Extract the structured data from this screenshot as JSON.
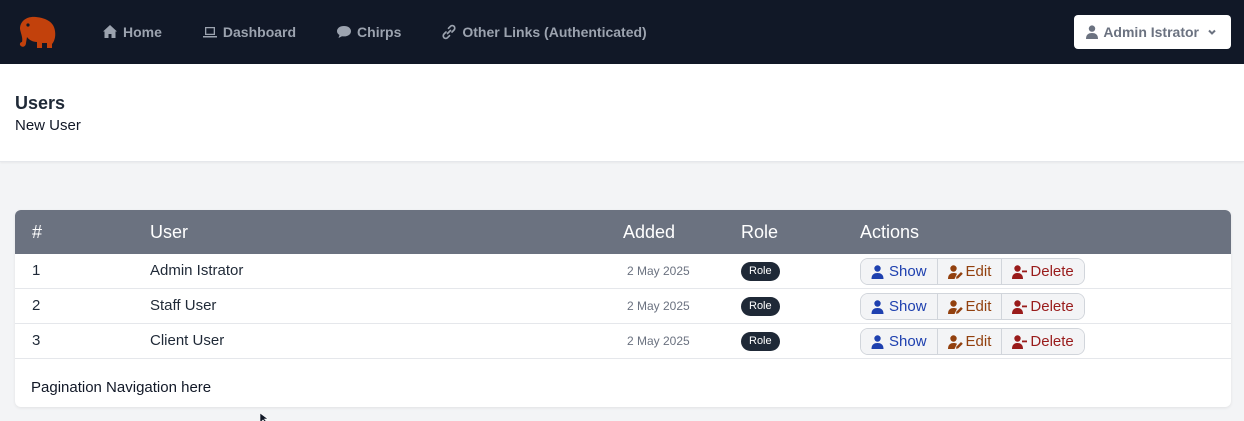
{
  "nav": {
    "logo": "elephant-logo",
    "links": [
      {
        "label": "Home",
        "icon": "home-icon"
      },
      {
        "label": "Dashboard",
        "icon": "laptop-icon"
      },
      {
        "label": "Chirps",
        "icon": "comment-icon"
      },
      {
        "label": "Other Links (Authenticated)",
        "icon": "link-icon"
      }
    ],
    "user_menu": "Admin Istrator"
  },
  "header": {
    "title": "Users",
    "subtitle_link": "New User"
  },
  "table": {
    "columns": [
      "#",
      "User",
      "Added",
      "Role",
      "Actions"
    ],
    "rows": [
      {
        "num": "1",
        "user": "Admin Istrator",
        "added": "2 May 2025",
        "role": "Role"
      },
      {
        "num": "2",
        "user": "Staff User",
        "added": "2 May 2025",
        "role": "Role"
      },
      {
        "num": "3",
        "user": "Client User",
        "added": "2 May 2025",
        "role": "Role"
      }
    ],
    "actions": {
      "show": "Show",
      "edit": "Edit",
      "delete": "Delete"
    },
    "pagination": "Pagination Navigation here"
  },
  "colors": {
    "nav_bg": "#111827",
    "logo": "#c2410c",
    "table_header": "#6b7280",
    "show": "#1e40af",
    "edit": "#92400e",
    "delete": "#991b1b"
  }
}
